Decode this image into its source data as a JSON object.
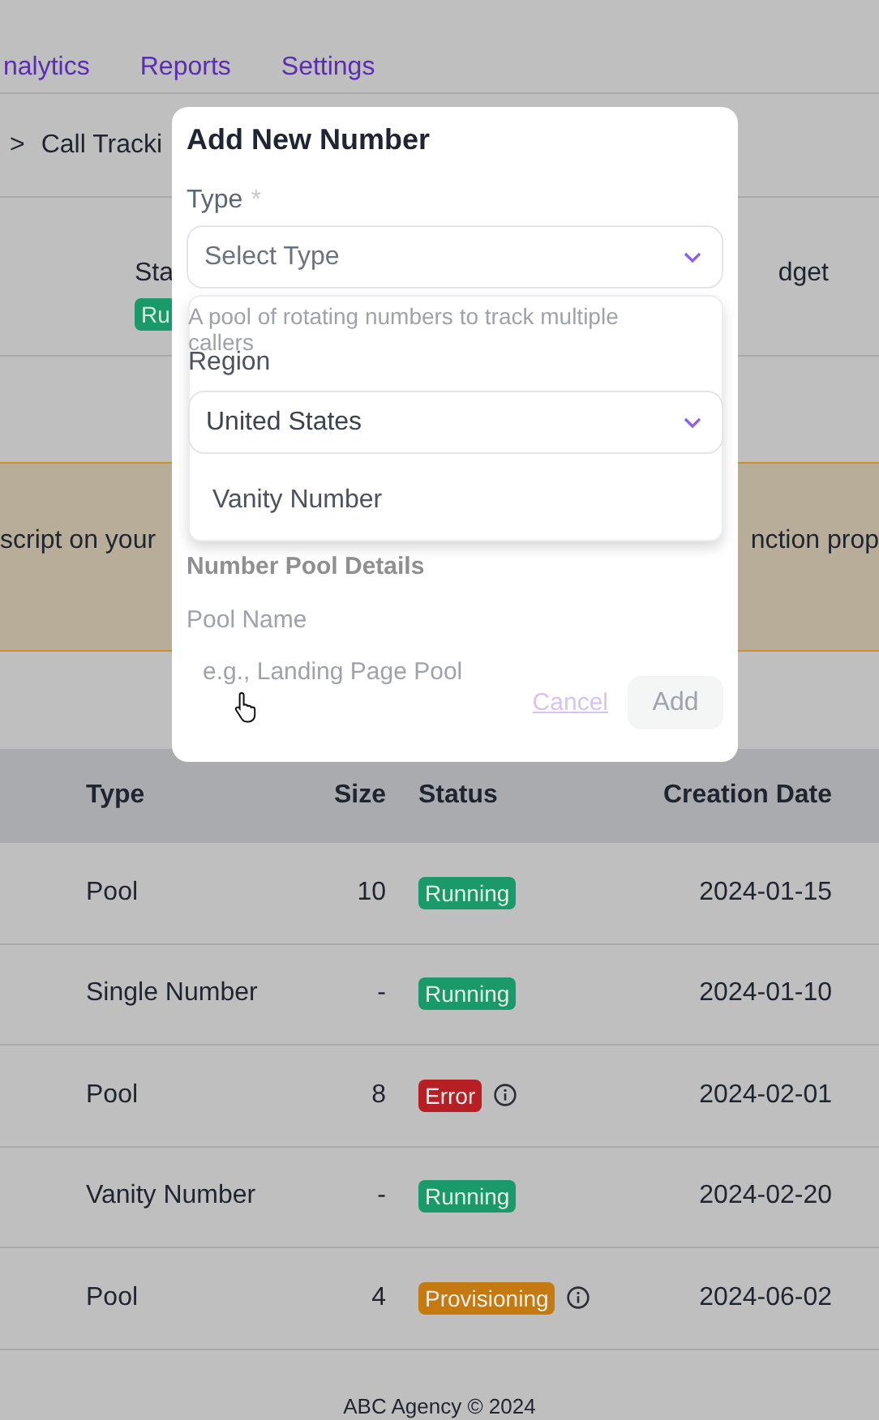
{
  "nav": {
    "tabs": [
      {
        "label": "nalytics",
        "selected": false
      },
      {
        "label": "Reports",
        "selected": false
      },
      {
        "label": "Settings",
        "selected": false
      }
    ]
  },
  "breadcrumb": {
    "separator": ">",
    "current": "Call Tracki"
  },
  "summary": {
    "status_label": "Sta",
    "status_badge": "Ru",
    "right_label": "dget"
  },
  "banner": {
    "left_text": "script on your",
    "right_text": "nction prop"
  },
  "table": {
    "columns": [
      "Type",
      "Size",
      "Status",
      "Creation Date"
    ],
    "rows": [
      {
        "type": "Pool",
        "size": "10",
        "status": {
          "label": "Running",
          "kind": "success"
        },
        "has_info": false,
        "date": "2024-01-15"
      },
      {
        "type": "Single Number",
        "size": "-",
        "status": {
          "label": "Running",
          "kind": "success"
        },
        "has_info": false,
        "date": "2024-01-10"
      },
      {
        "type": "Pool",
        "size": "8",
        "status": {
          "label": "Error",
          "kind": "error"
        },
        "has_info": true,
        "date": "2024-02-01"
      },
      {
        "type": "Vanity Number",
        "size": "-",
        "status": {
          "label": "Running",
          "kind": "success"
        },
        "has_info": false,
        "date": "2024-02-20"
      },
      {
        "type": "Pool",
        "size": "4",
        "status": {
          "label": "Provisioning",
          "kind": "warning"
        },
        "has_info": true,
        "date": "2024-06-02"
      }
    ]
  },
  "footer": "ABC Agency © 2024",
  "modal": {
    "title": "Add New Number",
    "type_label": "Type",
    "required_mark": "*",
    "type_placeholder": "Select Type",
    "dropdown": {
      "helper": "A pool of rotating numbers to track multiple callers",
      "region_label": "Region",
      "region_value": "United States",
      "option": "Vanity Number"
    },
    "section_title": "Number Pool Details",
    "pool_name_label": "Pool Name",
    "pool_name_placeholder": "e.g., Landing Page Pool",
    "cancel": "Cancel",
    "add": "Add",
    "add_disabled": true
  }
}
